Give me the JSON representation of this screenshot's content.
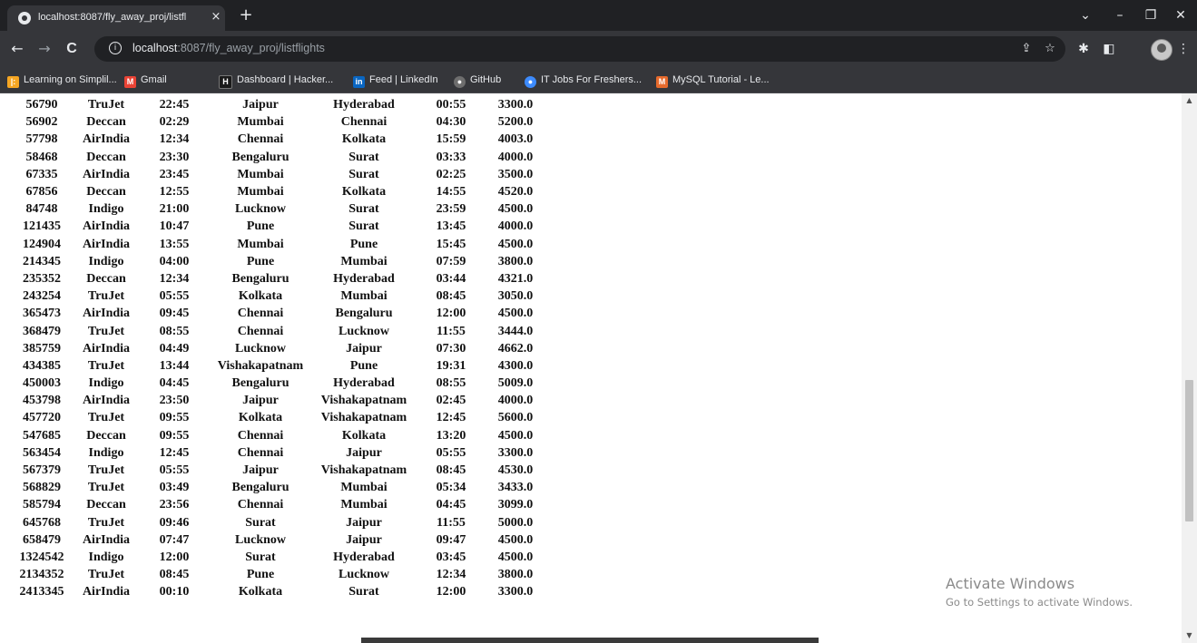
{
  "browser": {
    "tab_title": "localhost:8087/fly_away_proj/listfl",
    "tab_close": "×",
    "new_tab": "+",
    "window_controls": {
      "dropdown": "⌄",
      "minimize": "–",
      "restore": "❐",
      "close": "✕"
    },
    "nav": {
      "back": "←",
      "forward": "→",
      "reload": "C"
    },
    "address": {
      "info": "i",
      "host": "localhost",
      "path": ":8087/fly_away_proj/listflights"
    },
    "omnibox_icons": {
      "share": "⇪",
      "star": "☆"
    },
    "toolbar_icons": {
      "extensions": "✱",
      "sidepanel": "◧",
      "menu": "⋮"
    }
  },
  "bookmarks": [
    {
      "label": "Learning on Simplil...",
      "icon": "simplilearn-icon",
      "icon_text": "|:",
      "color": "#f5a623"
    },
    {
      "label": "Gmail",
      "icon": "gmail-icon",
      "icon_text": "M",
      "color": "#ea4335"
    },
    {
      "label": "Dashboard | Hacker...",
      "icon": "hackerrank-icon",
      "icon_text": "H",
      "color": "#1a1a1a"
    },
    {
      "label": "Feed | LinkedIn",
      "icon": "linkedin-icon",
      "icon_text": "in",
      "color": "#0a66c2"
    },
    {
      "label": "GitHub",
      "icon": "github-icon",
      "icon_text": "●",
      "color": "#8a8a8a"
    },
    {
      "label": "IT Jobs For Freshers...",
      "icon": "itjobs-icon",
      "icon_text": "●",
      "color": "#3d8bfd"
    },
    {
      "label": "MySQL Tutorial - Le...",
      "icon": "mysql-icon",
      "icon_text": "M",
      "color": "#e66a2c"
    }
  ],
  "flights": [
    [
      "56790",
      "TruJet",
      "22:45",
      "Jaipur",
      "Hyderabad",
      "00:55",
      "3300.0"
    ],
    [
      "56902",
      "Deccan",
      "02:29",
      "Mumbai",
      "Chennai",
      "04:30",
      "5200.0"
    ],
    [
      "57798",
      "AirIndia",
      "12:34",
      "Chennai",
      "Kolkata",
      "15:59",
      "4003.0"
    ],
    [
      "58468",
      "Deccan",
      "23:30",
      "Bengaluru",
      "Surat",
      "03:33",
      "4000.0"
    ],
    [
      "67335",
      "AirIndia",
      "23:45",
      "Mumbai",
      "Surat",
      "02:25",
      "3500.0"
    ],
    [
      "67856",
      "Deccan",
      "12:55",
      "Mumbai",
      "Kolkata",
      "14:55",
      "4520.0"
    ],
    [
      "84748",
      "Indigo",
      "21:00",
      "Lucknow",
      "Surat",
      "23:59",
      "4500.0"
    ],
    [
      "121435",
      "AirIndia",
      "10:47",
      "Pune",
      "Surat",
      "13:45",
      "4000.0"
    ],
    [
      "124904",
      "AirIndia",
      "13:55",
      "Mumbai",
      "Pune",
      "15:45",
      "4500.0"
    ],
    [
      "214345",
      "Indigo",
      "04:00",
      "Pune",
      "Mumbai",
      "07:59",
      "3800.0"
    ],
    [
      "235352",
      "Deccan",
      "12:34",
      "Bengaluru",
      "Hyderabad",
      "03:44",
      "4321.0"
    ],
    [
      "243254",
      "TruJet",
      "05:55",
      "Kolkata",
      "Mumbai",
      "08:45",
      "3050.0"
    ],
    [
      "365473",
      "AirIndia",
      "09:45",
      "Chennai",
      "Bengaluru",
      "12:00",
      "4500.0"
    ],
    [
      "368479",
      "TruJet",
      "08:55",
      "Chennai",
      "Lucknow",
      "11:55",
      "3444.0"
    ],
    [
      "385759",
      "AirIndia",
      "04:49",
      "Lucknow",
      "Jaipur",
      "07:30",
      "4662.0"
    ],
    [
      "434385",
      "TruJet",
      "13:44",
      "Vishakapatnam",
      "Pune",
      "19:31",
      "4300.0"
    ],
    [
      "450003",
      "Indigo",
      "04:45",
      "Bengaluru",
      "Hyderabad",
      "08:55",
      "5009.0"
    ],
    [
      "453798",
      "AirIndia",
      "23:50",
      "Jaipur",
      "Vishakapatnam",
      "02:45",
      "4000.0"
    ],
    [
      "457720",
      "TruJet",
      "09:55",
      "Kolkata",
      "Vishakapatnam",
      "12:45",
      "5600.0"
    ],
    [
      "547685",
      "Deccan",
      "09:55",
      "Chennai",
      "Kolkata",
      "13:20",
      "4500.0"
    ],
    [
      "563454",
      "Indigo",
      "12:45",
      "Chennai",
      "Jaipur",
      "05:55",
      "3300.0"
    ],
    [
      "567379",
      "TruJet",
      "05:55",
      "Jaipur",
      "Vishakapatnam",
      "08:45",
      "4530.0"
    ],
    [
      "568829",
      "TruJet",
      "03:49",
      "Bengaluru",
      "Mumbai",
      "05:34",
      "3433.0"
    ],
    [
      "585794",
      "Deccan",
      "23:56",
      "Chennai",
      "Mumbai",
      "04:45",
      "3099.0"
    ],
    [
      "645768",
      "TruJet",
      "09:46",
      "Surat",
      "Jaipur",
      "11:55",
      "5000.0"
    ],
    [
      "658479",
      "AirIndia",
      "07:47",
      "Lucknow",
      "Jaipur",
      "09:47",
      "4500.0"
    ],
    [
      "1324542",
      "Indigo",
      "12:00",
      "Surat",
      "Hyderabad",
      "03:45",
      "4500.0"
    ],
    [
      "2134352",
      "TruJet",
      "08:45",
      "Pune",
      "Lucknow",
      "12:34",
      "3800.0"
    ],
    [
      "2413345",
      "AirIndia",
      "00:10",
      "Kolkata",
      "Surat",
      "12:00",
      "3300.0"
    ]
  ],
  "watermark": {
    "title": "Activate Windows",
    "subtitle": "Go to Settings to activate Windows."
  },
  "scrollbar": {
    "up": "▲",
    "down": "▼"
  }
}
